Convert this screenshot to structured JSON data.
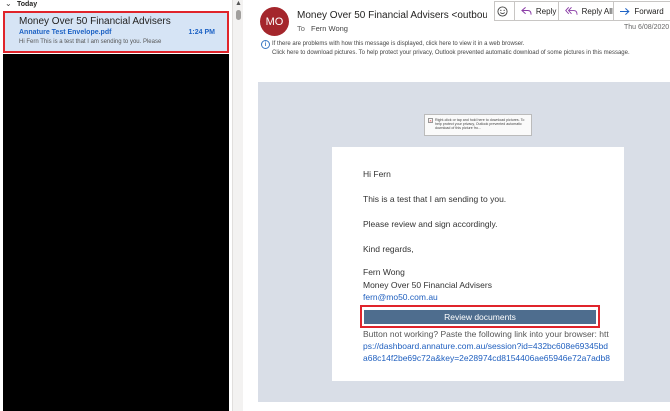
{
  "message_list": {
    "group_label": "Today",
    "selected_message": {
      "sender": "Money Over 50 Financial Advisers",
      "subject": "Annature Test Envelope.pdf",
      "time": "1:24 PM",
      "preview": "Hi Fern This is a test that I am sending to you. Please"
    }
  },
  "reading_pane": {
    "avatar_initials": "MO",
    "from": "Money Over 50 Financial Advisers <outbound@s",
    "to_label": "To",
    "to": "Fern Wong",
    "date": "Thu 6/08/2020",
    "actions": {
      "reply": "Reply",
      "reply_all": "Reply All",
      "forward": "Forward"
    },
    "info_line_1": "If there are problems with how this message is displayed, click here to view it in a web browser.",
    "info_line_2": "Click here to download pictures. To help protect your privacy, Outlook prevented automatic download of some pictures in this message."
  },
  "email": {
    "image_placeholder": "Right-click or tap and hold here to download pictures. To help protect your privacy, Outlook prevented automatic download of this picture fro...",
    "greeting": "Hi Fern",
    "line1": "This is a test that I am sending to you.",
    "line2": "Please review and sign accordingly.",
    "regards": "Kind regards,",
    "signature_name": "Fern Wong",
    "signature_company": "Money Over 50 Financial Advisers",
    "signature_email": "fern@mo50.com.au",
    "button_label": "Review documents",
    "fallback_text": "Button not working? Paste the following link into your browser: htt",
    "link_line1": "ps://dashboard.annature.com.au/session?id=432bc608e69345bd",
    "link_line2": "a68c14f2be69c72a&key=2e28974cd8154406ae65946e72a7adb8"
  },
  "colors": {
    "avatar": "#a4262c",
    "selection": "#d6e4f5",
    "highlight": "#e0242b",
    "button": "#4e6d8e",
    "link": "#1f5fbf"
  }
}
